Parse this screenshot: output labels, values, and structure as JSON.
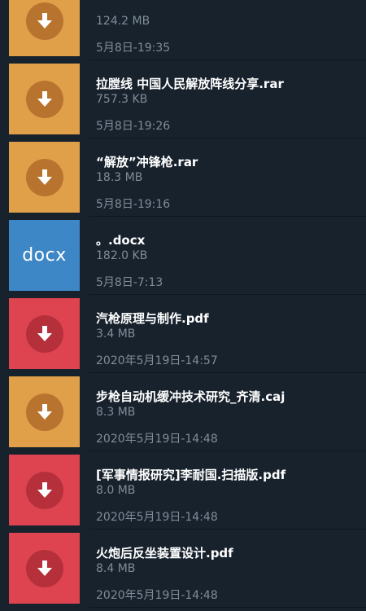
{
  "files": [
    {
      "name": "",
      "size": "124.2 MB",
      "date": "5月8日-19:35",
      "kind": "download",
      "color": "#e0a04a",
      "circle_color": "#b8742f"
    },
    {
      "name": "拉膛线 中国人民解放阵线分享.rar",
      "size": "757.3 KB",
      "date": "5月8日-19:26",
      "kind": "download",
      "color": "#e0a04a",
      "circle_color": "#b8742f"
    },
    {
      "name": "“解放”冲锋枪.rar",
      "size": "18.3 MB",
      "date": "5月8日-19:16",
      "kind": "download",
      "color": "#e0a04a",
      "circle_color": "#b8742f"
    },
    {
      "name": "。.docx",
      "size": "182.0 KB",
      "date": "5月8日-7:13",
      "kind": "docx",
      "label": "docx",
      "color": "#3e87c6"
    },
    {
      "name": "汽枪原理与制作.pdf",
      "size": "3.4 MB",
      "date": "2020年5月19日-14:57",
      "kind": "download",
      "color": "#dd4450",
      "circle_color": "#b5303b"
    },
    {
      "name": "步枪自动机缓冲技术研究_齐清.caj",
      "size": "8.3 MB",
      "date": "2020年5月19日-14:48",
      "kind": "download",
      "color": "#e0a04a",
      "circle_color": "#b8742f"
    },
    {
      "name": "[军事情报研究]李耐国.扫描版.pdf",
      "size": "8.0 MB",
      "date": "2020年5月19日-14:48",
      "kind": "download",
      "color": "#dd4450",
      "circle_color": "#b5303b"
    },
    {
      "name": "火炮后反坐装置设计.pdf",
      "size": "8.4 MB",
      "date": "2020年5月19日-14:48",
      "kind": "download",
      "color": "#dd4450",
      "circle_color": "#b5303b"
    }
  ]
}
